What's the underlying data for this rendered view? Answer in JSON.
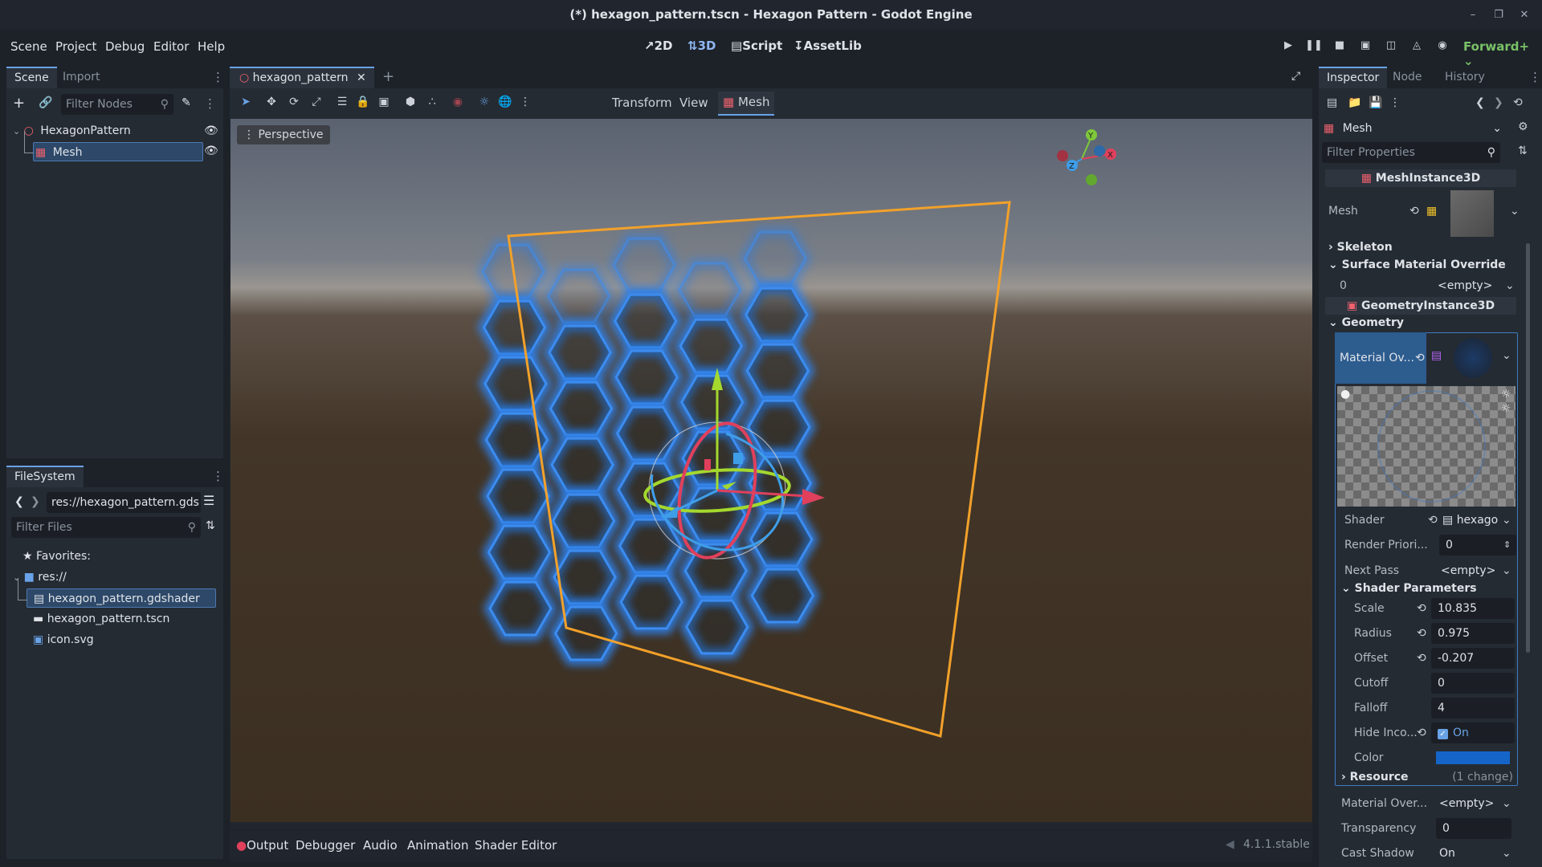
{
  "window": {
    "title": "(*) hexagon_pattern.tscn - Hexagon Pattern - Godot Engine"
  },
  "menu": [
    "Scene",
    "Project",
    "Debug",
    "Editor",
    "Help"
  ],
  "workspaces": [
    "2D",
    "3D",
    "Script",
    "AssetLib"
  ],
  "renderer": "Forward+",
  "scene_dock": {
    "tabs": [
      "Scene",
      "Import"
    ],
    "filter_placeholder": "Filter Nodes",
    "nodes": [
      {
        "name": "HexagonPattern"
      },
      {
        "name": "Mesh"
      }
    ]
  },
  "filesystem_dock": {
    "tab": "FileSystem",
    "path": "res://hexagon_pattern.gds",
    "filter_placeholder": "Filter Files",
    "favorites": "Favorites:",
    "root": "res://",
    "files": [
      "hexagon_pattern.gdshader",
      "hexagon_pattern.tscn",
      "icon.svg"
    ]
  },
  "editor": {
    "scene_tab": "hexagon_pattern",
    "toolbar": {
      "transform": "Transform",
      "view": "View",
      "mesh": "Mesh"
    },
    "perspective": "Perspective",
    "gizmo_axes": {
      "x": "X",
      "y": "Y",
      "z": "Z"
    }
  },
  "bottom_panel": {
    "tabs": [
      "Output",
      "Debugger",
      "Audio",
      "Animation",
      "Shader Editor"
    ],
    "version": "4.1.1.stable"
  },
  "inspector": {
    "tabs": [
      "Inspector",
      "Node",
      "History"
    ],
    "object": "Mesh",
    "filter_placeholder": "Filter Properties",
    "class1": "MeshInstance3D",
    "mesh_label": "Mesh",
    "skeleton": "Skeleton",
    "surface_override": "Surface Material Override",
    "surface_index": "0",
    "surface_value": "<empty>",
    "class2": "GeometryInstance3D",
    "geometry": "Geometry",
    "material_ov": "Material Ov...",
    "shader_label": "Shader",
    "shader_value": "hexago",
    "render_priority_label": "Render Priori...",
    "render_priority_value": "0",
    "next_pass_label": "Next Pass",
    "next_pass_value": "<empty>",
    "shader_params": "Shader Parameters",
    "params": [
      {
        "label": "Scale",
        "value": "10.835"
      },
      {
        "label": "Radius",
        "value": "0.975"
      },
      {
        "label": "Offset",
        "value": "-0.207"
      },
      {
        "label": "Cutoff",
        "value": "0"
      },
      {
        "label": "Falloff",
        "value": "4"
      }
    ],
    "hide_label": "Hide Inco...",
    "hide_value": "On",
    "color_label": "Color",
    "color_value": "#1565c8",
    "resource": "Resource",
    "resource_changes": "(1 change)",
    "material_over_label": "Material Over...",
    "material_over_value": "<empty>",
    "transparency_label": "Transparency",
    "transparency_value": "0",
    "cast_shadow_label": "Cast Shadow",
    "cast_shadow_value": "On"
  }
}
